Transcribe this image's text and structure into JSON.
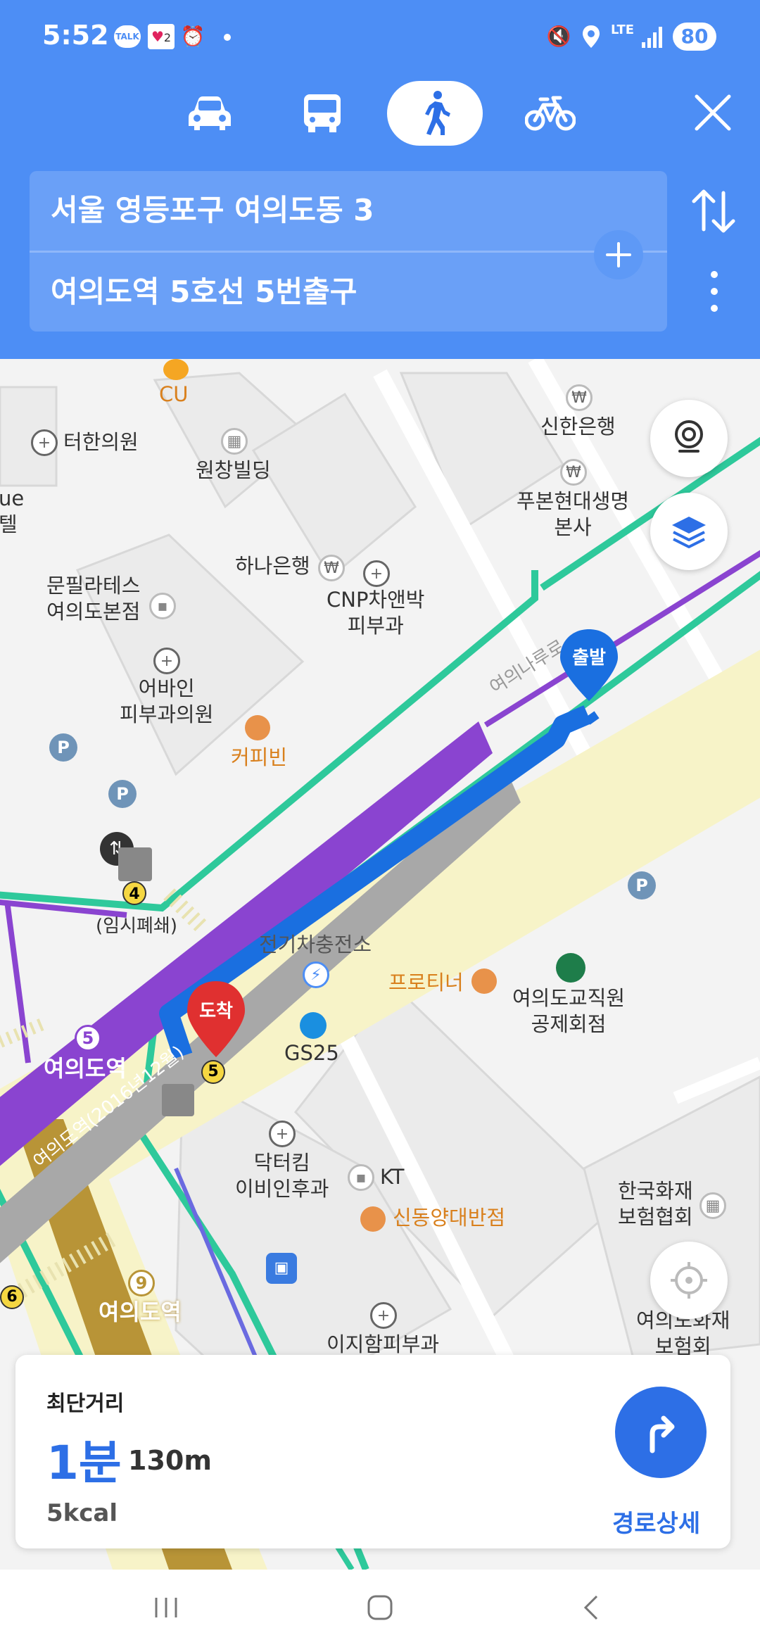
{
  "status_bar": {
    "time": "5:52",
    "talk_badge": "TALK",
    "heart_count": "2",
    "network": "LTE",
    "battery": "80"
  },
  "transport_modes": [
    {
      "name": "car",
      "icon": "car-icon"
    },
    {
      "name": "bus",
      "icon": "bus-icon"
    },
    {
      "name": "walk",
      "icon": "walk-icon",
      "active": true
    },
    {
      "name": "bicycle",
      "icon": "bicycle-icon"
    }
  ],
  "route": {
    "origin": "서울 영등포구 여의도동 3",
    "destination": "여의도역 5호선 5번출구"
  },
  "map": {
    "pois": {
      "cu": "CU",
      "clinic1": "터한의원",
      "wonchang": "원창빌딩",
      "shinhan": "신한은행",
      "fubon": "푸본현대생명\n본사",
      "hana": "하나은행",
      "cnp": "CNP차앤박\n피부과",
      "pilates": "문필라테스\n여의도본점",
      "abain": "어바인\n피부과의원",
      "coffee": "커피빈",
      "street": "여의나루로",
      "temp_closed": "(임시폐쇄)",
      "ev": "전기차충전소",
      "protini": "프로티너",
      "teachers": "여의도교직원\n공제회점",
      "gs25": "GS25",
      "doctorkim": "닥터킴\n이비인후과",
      "kt": "KT",
      "sindong": "신동양대반점",
      "insurance": "한국화재\n보험협회",
      "fire_ins": "여의도화재\n보험회",
      "ijiham": "이지함피부과",
      "station5": "여의도역",
      "station9": "여의도역",
      "station_label": "여의도역(2016년12월)",
      "left_cut": "ue\n텔"
    },
    "markers": {
      "start": "출발",
      "end": "도착"
    },
    "exit_numbers": {
      "e4": "4",
      "e5": "5",
      "e6": "6"
    },
    "line_badges": {
      "line5": "5",
      "line9": "9"
    }
  },
  "summary": {
    "route_type": "최단거리",
    "duration": "1분",
    "distance": "130m",
    "calories": "5kcal",
    "detail_label": "경로상세"
  },
  "colors": {
    "header": "#4d8ef5",
    "accent": "#2d6fe6",
    "line5": "#8a44d0",
    "line9": "#b89437",
    "road": "#f7f3c8",
    "green_path": "#2ec99b",
    "start_marker": "#1a6fe0",
    "end_marker": "#e03030"
  }
}
